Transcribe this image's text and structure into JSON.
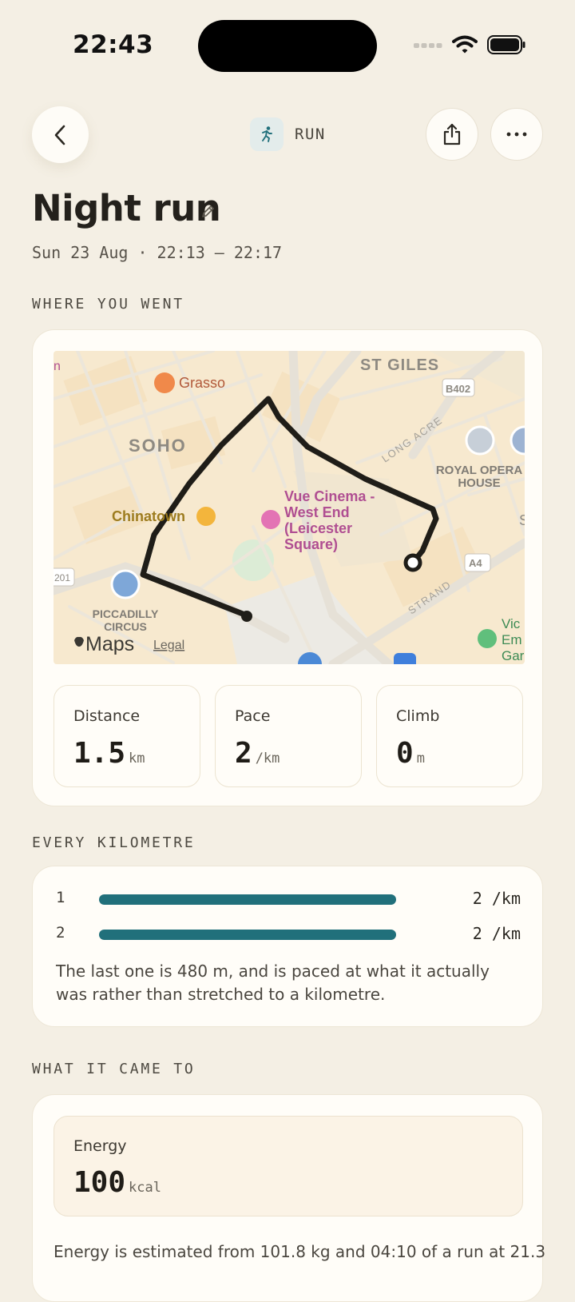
{
  "status_bar": {
    "time": "22:43"
  },
  "header": {
    "activity_type": "RUN"
  },
  "workout": {
    "title": "Night run",
    "date_time": "Sun 23 Aug · 22:13 – 22:17"
  },
  "sections": {
    "where": "WHERE YOU WENT",
    "splits": "EVERY KILOMETRE",
    "totals": "WHAT IT CAME TO"
  },
  "map": {
    "labels": {
      "grasso": "Grasso",
      "st_giles": "ST GILES",
      "b402": "B402",
      "soho": "SOHO",
      "long_acre": "LONG ACRE",
      "royal_opera_1": "ROYAL OPERA",
      "royal_opera_2": "HOUSE",
      "chinatown": "Chinatown",
      "vue_1": "Vue Cinema -",
      "vue_2": "West End",
      "vue_3": "(Leicester",
      "vue_4": "Square)",
      "a4": "A4",
      "strand": "STRAND",
      "a201": "201",
      "piccadilly_1": "PICCADILLY",
      "piccadilly_2": "CIRCUS",
      "vic_1": "Vic",
      "vic_2": "Em",
      "vic_3": "Gar",
      "edge_m": "n",
      "edge_s": "S"
    },
    "attribution": "Maps",
    "legal": "Legal"
  },
  "stats": [
    {
      "label": "Distance",
      "value": "1.5",
      "unit": "km"
    },
    {
      "label": "Pace",
      "value": "2",
      "unit": "/km"
    },
    {
      "label": "Climb",
      "value": "0",
      "unit": "m"
    }
  ],
  "splits": [
    {
      "index": "1",
      "pace": "2 /km",
      "fill": 1.0
    },
    {
      "index": "2",
      "pace": "2 /km",
      "fill": 1.0
    }
  ],
  "splits_note": "The last one is 480 m, and is paced at what it actually was rather than stretched to a kilometre.",
  "energy": {
    "label": "Energy",
    "value": "100",
    "unit": "kcal"
  },
  "energy_note": "Energy is estimated from 101.8 kg and 04:10 of a run at 21.3",
  "colors": {
    "accent": "#21707b",
    "route": "#1f1d18",
    "background": "#f4efe4"
  }
}
